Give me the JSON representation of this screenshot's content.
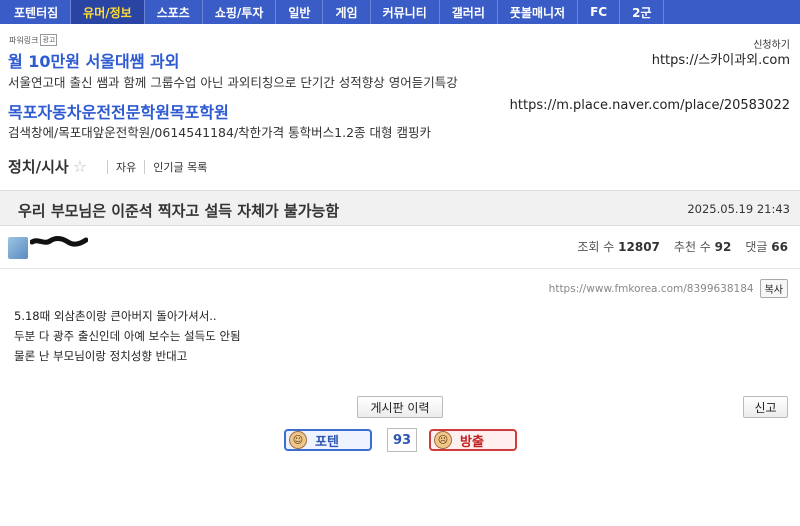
{
  "nav": {
    "items": [
      "포텐터짐",
      "유머/정보",
      "스포츠",
      "쇼핑/투자",
      "일반",
      "게임",
      "커뮤니티",
      "갤러리",
      "풋볼매니저",
      "FC",
      "2군"
    ],
    "active_index": 1
  },
  "ads": {
    "label": "파워링크",
    "label_badge": "광고",
    "ad1": {
      "title": "월 10만원 서울대쌤 과외",
      "desc": "서울연고대 출신 쌤과 함께 그룹수업 아닌 과외티칭으로 단기간 성적향상 영어듣기특강",
      "apply": "신청하기",
      "url": "https://스카이과외.com"
    },
    "ad2": {
      "title": "목포자동차운전전문학원목포학원",
      "desc": "검색창에/목포대앞운전학원/0614541184/착한가격 통학버스1.2종 대형 캠핑카",
      "url": "https://m.place.naver.com/place/20583022"
    }
  },
  "board": {
    "title": "정치/시사",
    "star_icon": "star-outline-icon",
    "links": [
      "자유",
      "인기글 목록"
    ]
  },
  "post": {
    "title": "우리 부모님은 이준석 찍자고 설득 자체가 불가능함",
    "date": "2025.05.19 21:43",
    "views_label": "조회 수",
    "views": "12807",
    "recommend_label": "추천 수",
    "recommend": "92",
    "comments_label": "댓글",
    "comments": "66",
    "url": "https://www.fmkorea.com/8399638184",
    "copy_label": "복사",
    "body": [
      "5.18때 외삼촌이랑 큰아버지 돌아가셔서..",
      "두분 다 광주 출신인데 아예 보수는 설득도 안됨",
      "물론 난 부모님이랑 정치성향 반대고"
    ]
  },
  "actions": {
    "history_label": "게시판 이력",
    "report_label": "신고",
    "vote_up_label": "포텐",
    "vote_count": "93",
    "vote_down_label": "방출"
  }
}
